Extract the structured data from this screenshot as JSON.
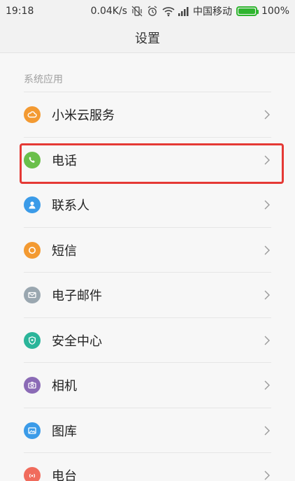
{
  "status": {
    "time": "19:18",
    "speed": "0.04K/s",
    "carrier": "中国移动",
    "battery_pct": "100%",
    "battery_level": 1.0
  },
  "title": "设置",
  "section": "系统应用",
  "items": [
    {
      "label": "小米云服务",
      "icon": "cloud-icon",
      "color": "#f39a32"
    },
    {
      "label": "电话",
      "icon": "phone-icon",
      "color": "#6abf4b"
    },
    {
      "label": "联系人",
      "icon": "person-icon",
      "color": "#3b9be8"
    },
    {
      "label": "短信",
      "icon": "message-icon",
      "color": "#f39a32"
    },
    {
      "label": "电子邮件",
      "icon": "mail-icon",
      "color": "#9aa7b0"
    },
    {
      "label": "安全中心",
      "icon": "shield-icon",
      "color": "#2bb59a"
    },
    {
      "label": "相机",
      "icon": "camera-icon",
      "color": "#8b6bb6"
    },
    {
      "label": "图库",
      "icon": "gallery-icon",
      "color": "#3b9be8"
    },
    {
      "label": "电台",
      "icon": "radio-icon",
      "color": "#f06b5c"
    }
  ],
  "highlight_color": "#e53935"
}
